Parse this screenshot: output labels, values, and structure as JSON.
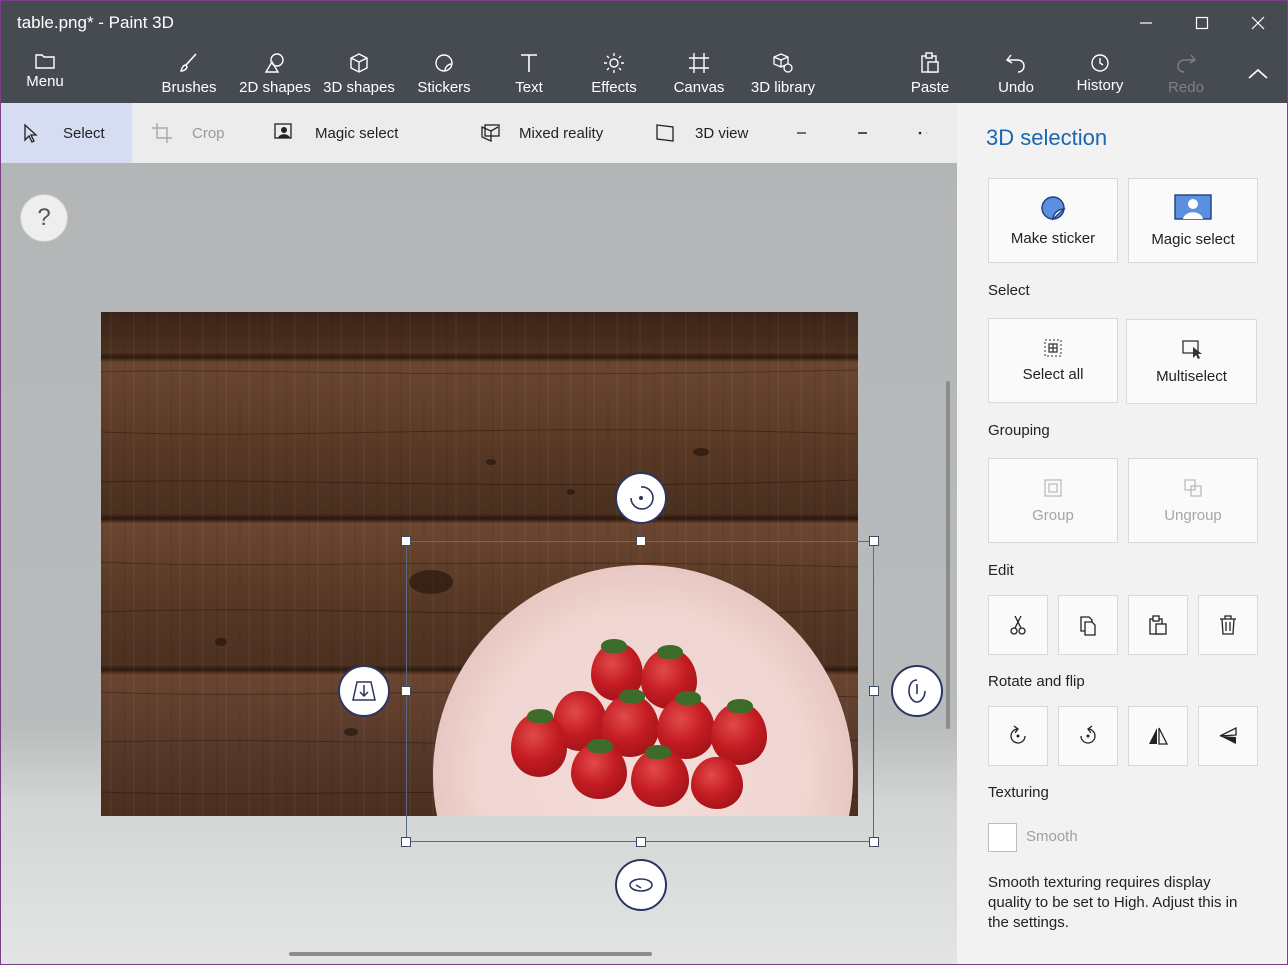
{
  "window": {
    "title": "table.png* - Paint 3D"
  },
  "ribbon": {
    "menu": "Menu",
    "brushes": "Brushes",
    "shapes2d": "2D shapes",
    "shapes3d": "3D shapes",
    "stickers": "Stickers",
    "text": "Text",
    "effects": "Effects",
    "canvas": "Canvas",
    "library3d": "3D library",
    "paste": "Paste",
    "undo": "Undo",
    "history": "History",
    "redo": "Redo"
  },
  "toolbar": {
    "select": "Select",
    "crop": "Crop",
    "magic_select": "Magic select",
    "mixed_reality": "Mixed reality",
    "view3d": "3D view"
  },
  "canvas": {
    "help": "?"
  },
  "panel": {
    "title": "3D selection",
    "make_sticker": "Make sticker",
    "magic_select": "Magic select",
    "select_heading": "Select",
    "select_all": "Select all",
    "multiselect": "Multiselect",
    "grouping_heading": "Grouping",
    "group": "Group",
    "ungroup": "Ungroup",
    "edit_heading": "Edit",
    "rotate_heading": "Rotate and flip",
    "texturing_heading": "Texturing",
    "smooth": "Smooth",
    "note": "Smooth texturing requires display quality to be set to High. Adjust this in the settings."
  },
  "colors": {
    "accent": "#1a66b0",
    "chrome": "#464b52",
    "selected_tool": "#d6dcf2"
  }
}
